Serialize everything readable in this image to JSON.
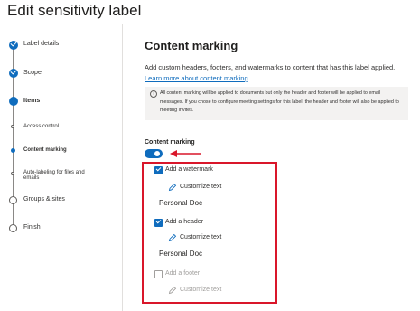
{
  "page": {
    "title": "Edit sensitivity label"
  },
  "steps": [
    {
      "label": "Label details",
      "state": "completed"
    },
    {
      "label": "Scope",
      "state": "completed"
    },
    {
      "label": "Items",
      "state": "current"
    },
    {
      "label": "Access control",
      "state": "substep"
    },
    {
      "label": "Content marking",
      "state": "current-substep"
    },
    {
      "label": "Auto-labeling for files and",
      "label_line2": "emails",
      "state": "substep"
    },
    {
      "label": "Groups & sites",
      "state": "pending"
    },
    {
      "label": "Finish",
      "state": "pending"
    }
  ],
  "main": {
    "heading": "Content marking",
    "description": "Add custom headers, footers, and watermarks to content that has this label applied.",
    "learn_more": "Learn more about content marking",
    "info": "All content marking will be applied to documents but only the header and footer will be applied to email messages. If you chose to configure meeting settings for this label, the header and footer will also be applied to meeting invites.",
    "content_marking_label": "Content marking",
    "toggle_on": true,
    "options": {
      "watermark": {
        "label": "Add a watermark",
        "checked": true,
        "customize": "Customize text",
        "preview": "Personal Doc"
      },
      "header": {
        "label": "Add a header",
        "checked": true,
        "customize": "Customize text",
        "preview": "Personal Doc"
      },
      "footer": {
        "label": "Add a footer",
        "checked": false,
        "customize": "Customize text"
      }
    }
  },
  "colors": {
    "accent": "#0f6cbd",
    "highlight": "#d9162a",
    "disabled": "#a19f9d"
  }
}
